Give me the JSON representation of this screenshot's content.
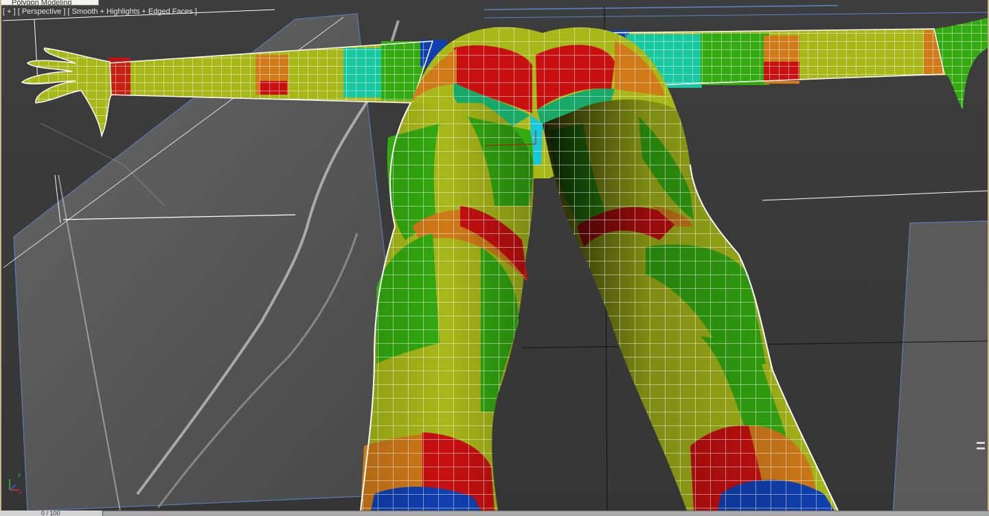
{
  "ribbon": {
    "tab_label": "Polygon Modeling"
  },
  "viewport": {
    "label_plus": "[ + ]",
    "label_view": "[ Perspective ]",
    "label_shading": "[ Smooth + Highlights + Edged Faces ]"
  },
  "time_slider": {
    "label": "0 / 100"
  },
  "colors": {
    "viewport_bg": "#3b3b3b",
    "wire": "#ffffff",
    "green": "#33aa10",
    "yellow_green": "#a8b818",
    "red": "#c81010",
    "orange": "#d07a18",
    "teal": "#18c8a0",
    "blue": "#1040b0",
    "selection_outline": "#5b86c8"
  },
  "icons": [
    "axis-tripod-icon"
  ]
}
